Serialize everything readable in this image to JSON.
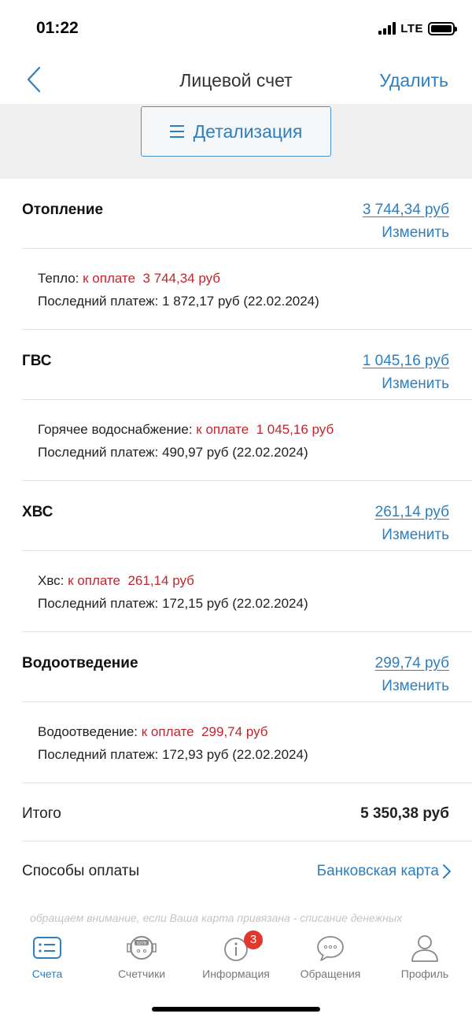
{
  "status_bar": {
    "time": "01:22",
    "network": "LTE"
  },
  "nav": {
    "title": "Лицевой счет",
    "action_label": "Удалить"
  },
  "detail_button": {
    "label": "Детализация"
  },
  "services": [
    {
      "name": "Отопление",
      "amount": "3 744,34 руб",
      "change_label": "Изменить",
      "detail_name": "Тепло:",
      "due_label": "к оплате",
      "due_amount": "3 744,34 руб",
      "last_payment": "Последний платеж: 1 872,17 руб (22.02.2024)"
    },
    {
      "name": "ГВС",
      "amount": "1 045,16 руб",
      "change_label": "Изменить",
      "detail_name": "Горячее водоснабжение:",
      "due_label": "к оплате",
      "due_amount": "1 045,16 руб",
      "last_payment": "Последний платеж: 490,97 руб (22.02.2024)"
    },
    {
      "name": "ХВС",
      "amount": "261,14 руб",
      "change_label": "Изменить",
      "detail_name": "Хвс:",
      "due_label": "к оплате",
      "due_amount": "261,14 руб",
      "last_payment": "Последний платеж: 172,15 руб (22.02.2024)"
    },
    {
      "name": "Водоотведение",
      "amount": "299,74 руб",
      "change_label": "Изменить",
      "detail_name": "Водоотведение:",
      "due_label": "к оплате",
      "due_amount": "299,74 руб",
      "last_payment": "Последний платеж: 172,93 руб (22.02.2024)"
    }
  ],
  "total": {
    "label": "Итого",
    "value": "5 350,38 руб"
  },
  "payment_methods": {
    "label": "Способы оплаты",
    "value": "Банковская карта"
  },
  "notice": "обращаем внимание, если Ваша карта привязана - списание денежных",
  "tabbar": {
    "tabs": [
      {
        "label": "Счета",
        "icon": "bills-icon",
        "active": true
      },
      {
        "label": "Счетчики",
        "icon": "meter-icon",
        "meter_digits": "5379"
      },
      {
        "label": "Информация",
        "icon": "info-icon",
        "badge": "3"
      },
      {
        "label": "Обращения",
        "icon": "chat-icon"
      },
      {
        "label": "Профиль",
        "icon": "profile-icon"
      }
    ]
  },
  "colors": {
    "accent": "#2f7fbe",
    "due": "#c0262d",
    "badge": "#e2382c",
    "band": "#f0f0f0"
  }
}
